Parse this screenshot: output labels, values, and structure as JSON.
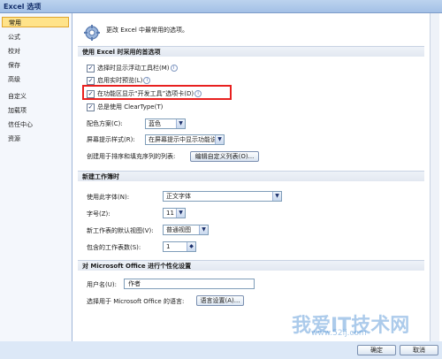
{
  "window": {
    "title": "Excel 选项"
  },
  "sidebar": {
    "items": [
      {
        "label": "常用",
        "selected": true
      },
      {
        "label": "公式"
      },
      {
        "label": "校对"
      },
      {
        "label": "保存"
      },
      {
        "label": "高级"
      },
      {
        "label": "自定义"
      },
      {
        "label": "加载项"
      },
      {
        "label": "信任中心"
      },
      {
        "label": "资源"
      }
    ]
  },
  "header": {
    "text": "更改 Excel 中最常用的选项。"
  },
  "sections": {
    "top": {
      "title": "使用 Excel 时采用的首选项",
      "cb1": "选择时显示浮动工具栏(M)",
      "cb2": "启用实时预览(L)",
      "cb3": "在功能区显示“开发工具”选项卡(D)",
      "cb4": "总是使用 ClearType(T)",
      "color_label": "配色方案(C):",
      "color_value": "蓝色",
      "tip_label": "屏幕提示样式(R):",
      "tip_value": "在屏幕提示中显示功能说明",
      "list_label": "创建用于排序和填充序列的列表:",
      "list_button": "编辑自定义列表(O)..."
    },
    "newbook": {
      "title": "新建工作簿时",
      "font_label": "使用此字体(N):",
      "font_value": "正文字体",
      "size_label": "字号(Z):",
      "size_value": "11",
      "view_label": "新工作表的默认视图(V):",
      "view_value": "普通视图",
      "sheets_label": "包含的工作表数(S):",
      "sheets_value": "1"
    },
    "personal": {
      "title": "对 Microsoft Office 进行个性化设置",
      "user_label": "用户名(U):",
      "user_value": "作者",
      "lang_label": "选择用于 Microsoft Office 的语言:",
      "lang_button": "语言设置(A)..."
    }
  },
  "footer": {
    "ok": "确定",
    "cancel": "取消"
  },
  "watermark": {
    "main": "我爱IT技术网",
    "sub": "www.52ij.com"
  }
}
